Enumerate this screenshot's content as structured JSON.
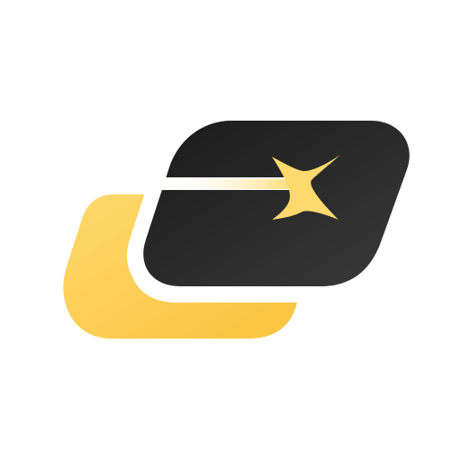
{
  "logo": {
    "icon": "star-card-logo",
    "colors": {
      "background": "#ffffff",
      "back_card_light": "#ffd96e",
      "back_card_dark": "#f9c33c",
      "front_card_dark": "#1a1a1a",
      "front_card_light": "#3a3a3a",
      "star": "#ffd96e",
      "streak_start": "#ffffff",
      "streak_end": "#ffd96e"
    }
  }
}
